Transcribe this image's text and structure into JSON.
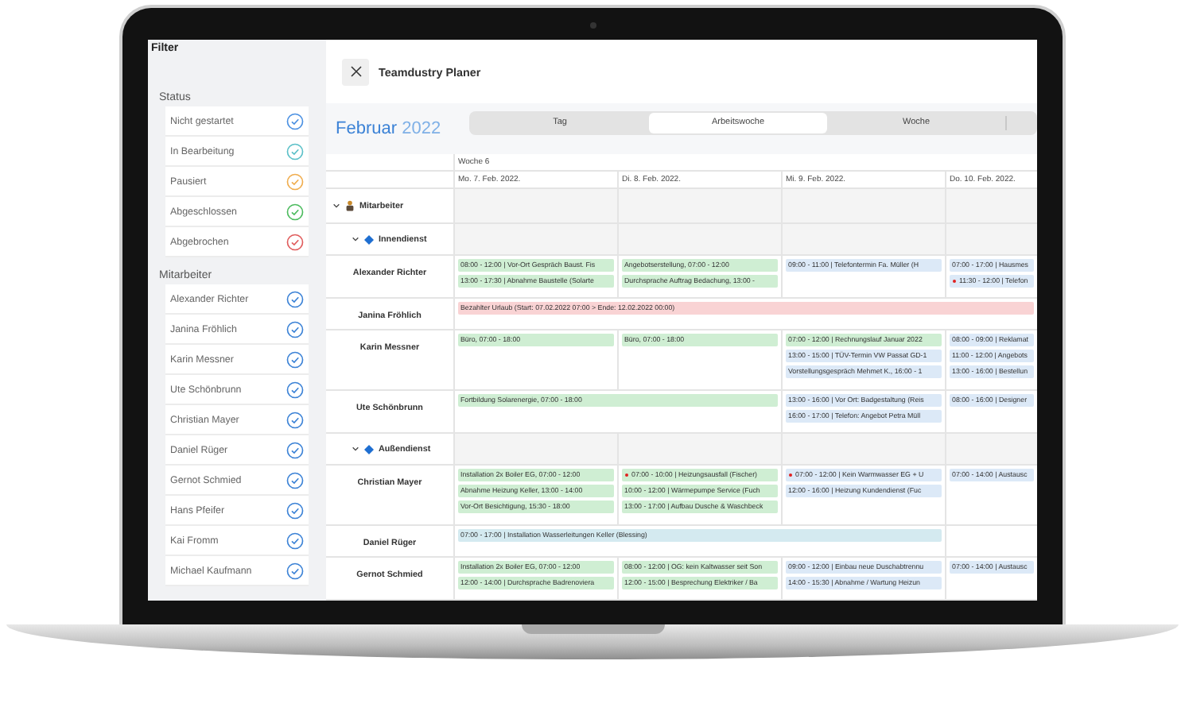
{
  "filter": {
    "title": "Filter",
    "status_title": "Status",
    "status": [
      {
        "label": "Nicht gestartet",
        "checked": true,
        "color": "#4a90e2"
      },
      {
        "label": "In Bearbeitung",
        "checked": true,
        "color": "#5bc0c8"
      },
      {
        "label": "Pausiert",
        "checked": true,
        "color": "#f0ad4e"
      },
      {
        "label": "Abgeschlossen",
        "checked": true,
        "color": "#4cbb5e"
      },
      {
        "label": "Abgebrochen",
        "checked": true,
        "color": "#e05c5c"
      }
    ],
    "people_title": "Mitarbeiter",
    "people": [
      {
        "label": "Alexander Richter",
        "checked": true
      },
      {
        "label": "Janina Fröhlich",
        "checked": true
      },
      {
        "label": "Karin Messner",
        "checked": true
      },
      {
        "label": "Ute Schönbrunn",
        "checked": true
      },
      {
        "label": "Christian Mayer",
        "checked": true
      },
      {
        "label": "Daniel Rüger",
        "checked": true
      },
      {
        "label": "Gernot Schmied",
        "checked": true
      },
      {
        "label": "Hans Pfeifer",
        "checked": true
      },
      {
        "label": "Kai Fromm",
        "checked": true
      },
      {
        "label": "Michael Kaufmann",
        "checked": true
      }
    ]
  },
  "header": {
    "title": "Teamdustry Planer"
  },
  "month": {
    "name": "Februar",
    "year": "2022"
  },
  "tabs": [
    {
      "label": "Tag",
      "selected": false
    },
    {
      "label": "Arbeitswoche",
      "selected": true
    },
    {
      "label": "Woche",
      "selected": false
    }
  ],
  "week": "Woche 6",
  "days": [
    "Mo. 7. Feb. 2022.",
    "Di. 8. Feb. 2022.",
    "Mi. 9. Feb. 2022.",
    "Do. 10. Feb. 2022."
  ],
  "resources": [
    {
      "label": "Mitarbeiter",
      "expanded": true,
      "children": [
        {
          "label": "Innendienst",
          "expanded": true,
          "children": [
            {
              "name": "Alexander Richter",
              "cells": [
                {
                  "events": [
                    {
                      "text": "08:00 - 12:00 | Vor-Ort Gespräch Baust. Fis",
                      "color": "#cfeed3",
                      "marked": false
                    },
                    {
                      "text": "13:00 - 17:30 | Abnahme Baustelle (Solarte",
                      "color": "#cfeed3",
                      "marked": false
                    }
                  ]
                },
                {
                  "events": [
                    {
                      "text": "Angebotserstellung, 07:00 - 12:00",
                      "color": "#cfeed3",
                      "marked": false
                    },
                    {
                      "text": "Durchsprache Auftrag Bedachung, 13:00 -",
                      "color": "#cfeed3",
                      "marked": false
                    }
                  ]
                },
                {
                  "events": [
                    {
                      "text": "09:00 - 11:00 | Telefontermin Fa. Müller (H",
                      "color": "#dce9f7",
                      "marked": false
                    }
                  ]
                },
                {
                  "events": [
                    {
                      "text": "07:00 - 17:00 | Hausmes",
                      "color": "#dce9f7",
                      "marked": false
                    },
                    {
                      "text": "11:30 - 12:00 | Telefon",
                      "color": "#dce9f7",
                      "marked": true
                    }
                  ]
                }
              ]
            },
            {
              "name": "Janina Fröhlich",
              "cells": [
                {
                  "events": [
                    {
                      "text": "Bezahlter Urlaub (Start: 07.02.2022 07:00 > Ende: 12.02.2022 00:00)",
                      "color": "#f9d3d4",
                      "marked": false
                    }
                  ]
                },
                {
                  "joined": true
                },
                {
                  "joined": true
                },
                {
                  "joined": true
                }
              ]
            },
            {
              "name": "Karin Messner",
              "cells": [
                {
                  "events": [
                    {
                      "text": "Büro, 07:00 - 18:00",
                      "color": "#cfeed3",
                      "marked": false
                    }
                  ]
                },
                {
                  "events": [
                    {
                      "text": "Büro, 07:00 - 18:00",
                      "color": "#cfeed3",
                      "marked": false
                    }
                  ]
                },
                {
                  "events": [
                    {
                      "text": "07:00 - 12:00 | Rechnungslauf Januar 2022",
                      "color": "#cfeed3",
                      "marked": false
                    },
                    {
                      "text": "13:00 - 15:00 | TÜV-Termin VW Passat GD-1",
                      "color": "#dce9f7",
                      "marked": false
                    },
                    {
                      "text": "Vorstellungsgespräch Mehmet K., 16:00 - 1",
                      "color": "#dce9f7",
                      "marked": false
                    }
                  ]
                },
                {
                  "events": [
                    {
                      "text": "08:00 - 09:00 | Reklamat",
                      "color": "#dce9f7",
                      "marked": false
                    },
                    {
                      "text": "11:00 - 12:00 | Angebots",
                      "color": "#dce9f7",
                      "marked": false
                    },
                    {
                      "text": "13:00 - 16:00 | Bestellun",
                      "color": "#dce9f7",
                      "marked": false
                    }
                  ]
                }
              ]
            },
            {
              "name": "Ute Schönbrunn",
              "cells": [
                {
                  "events": [
                    {
                      "text": "Fortbildung Solarenergie, 07:00 - 18:00",
                      "color": "#cfeed3",
                      "marked": false
                    }
                  ]
                },
                {
                  "joined": true
                },
                {
                  "events": [
                    {
                      "text": "13:00 - 16:00 | Vor Ort: Badgestaltung (Reis",
                      "color": "#dce9f7",
                      "marked": false
                    },
                    {
                      "text": "16:00 - 17:00 | Telefon: Angebot Petra Müll",
                      "color": "#dce9f7",
                      "marked": false
                    }
                  ]
                },
                {
                  "events": [
                    {
                      "text": "08:00 - 16:00 | Designer",
                      "color": "#dce9f7",
                      "marked": false
                    }
                  ]
                }
              ]
            }
          ]
        },
        {
          "label": "Außendienst",
          "expanded": true,
          "children": [
            {
              "name": "Christian Mayer",
              "cells": [
                {
                  "events": [
                    {
                      "text": "Installation 2x Boiler EG, 07:00 - 12:00",
                      "color": "#cfeed3",
                      "marked": false
                    },
                    {
                      "text": "Abnahme Heizung Keller, 13:00 - 14:00",
                      "color": "#cfeed3",
                      "marked": false
                    },
                    {
                      "text": "Vor-Ort Besichtigung, 15:30 - 18:00",
                      "color": "#cfeed3",
                      "marked": false
                    }
                  ]
                },
                {
                  "events": [
                    {
                      "text": "07:00 - 10:00 | Heizungsausfall (Fischer)",
                      "color": "#cfeed3",
                      "marked": true
                    },
                    {
                      "text": "10:00 - 12:00 | Wärmepumpe Service (Fuch",
                      "color": "#cfeed3",
                      "marked": false
                    },
                    {
                      "text": "13:00 - 17:00 | Aufbau Dusche & Waschbeck",
                      "color": "#cfeed3",
                      "marked": false
                    }
                  ]
                },
                {
                  "events": [
                    {
                      "text": "07:00 - 12:00 | Kein Warmwasser EG + U",
                      "color": "#dce9f7",
                      "marked": true
                    },
                    {
                      "text": "12:00 - 16:00 | Heizung Kundendienst (Fuc",
                      "color": "#dce9f7",
                      "marked": false
                    }
                  ]
                },
                {
                  "events": [
                    {
                      "text": "07:00 - 14:00 | Austausc",
                      "color": "#dce9f7",
                      "marked": false
                    }
                  ]
                }
              ]
            },
            {
              "name": "Daniel Rüger",
              "cells": [
                {
                  "events": [
                    {
                      "text": "07:00 - 17:00 | Installation Wasserleitungen Keller (Blessing)",
                      "color": "#d4eaf0",
                      "marked": false
                    }
                  ]
                },
                {
                  "joined": true
                },
                {
                  "joined": true
                }
              ]
            },
            {
              "name": "Gernot Schmied",
              "cells": [
                {
                  "events": [
                    {
                      "text": "Installation 2x Boiler EG, 07:00 - 12:00",
                      "color": "#cfeed3",
                      "marked": false
                    },
                    {
                      "text": "12:00 - 14:00 | Durchsprache Badrenoviera",
                      "color": "#cfeed3",
                      "marked": false
                    }
                  ]
                },
                {
                  "events": [
                    {
                      "text": "08:00 - 12:00 | OG: kein Kaltwasser seit Son",
                      "color": "#cfeed3",
                      "marked": false
                    },
                    {
                      "text": "12:00 - 15:00 | Besprechung Elektriker / Ba",
                      "color": "#cfeed3",
                      "marked": false
                    }
                  ]
                },
                {
                  "events": [
                    {
                      "text": "09:00 - 12:00 | Einbau neue Duschabtrennu",
                      "color": "#dce9f7",
                      "marked": false
                    },
                    {
                      "text": "14:00 - 15:30 | Abnahme / Wartung Heizun",
                      "color": "#dce9f7",
                      "marked": false
                    }
                  ]
                },
                {
                  "events": [
                    {
                      "text": "07:00 - 14:00 | Austausc",
                      "color": "#dce9f7",
                      "marked": false
                    }
                  ]
                }
              ]
            }
          ]
        }
      ]
    }
  ]
}
